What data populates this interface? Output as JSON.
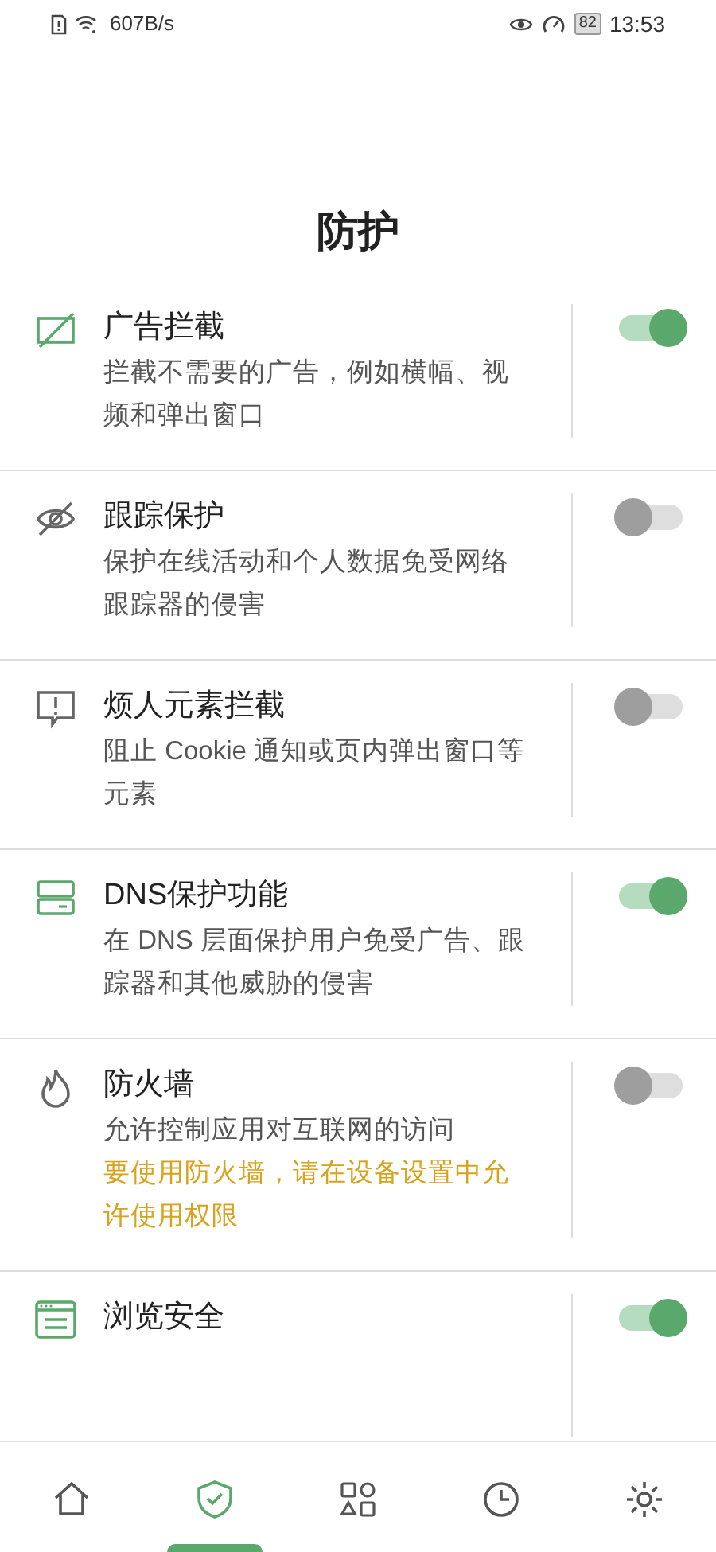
{
  "status_bar": {
    "speed": "607B/s",
    "battery": "82",
    "time": "13:53"
  },
  "title": "防护",
  "features": [
    {
      "title": "广告拦截",
      "description": "拦截不需要的广告，例如横幅、视频和弹出窗口",
      "on": true
    },
    {
      "title": "跟踪保护",
      "description": "保护在线活动和个人数据免受网络跟踪器的侵害",
      "on": false
    },
    {
      "title": "烦人元素拦截",
      "description": "阻止 Cookie 通知或页内弹出窗口等元素",
      "on": false
    },
    {
      "title": "DNS保护功能",
      "description": "在 DNS 层面保护用户免受广告、跟踪器和其他威胁的侵害",
      "on": true
    },
    {
      "title": "防火墙",
      "description": "允许控制应用对互联网的访问",
      "warning": "要使用防火墙，请在设备设置中允许使用权限",
      "on": false
    },
    {
      "title": "浏览安全",
      "on": true
    }
  ],
  "nav": [
    {
      "selected": false
    },
    {
      "selected": true
    },
    {
      "selected": false
    },
    {
      "selected": false
    },
    {
      "selected": false
    }
  ]
}
